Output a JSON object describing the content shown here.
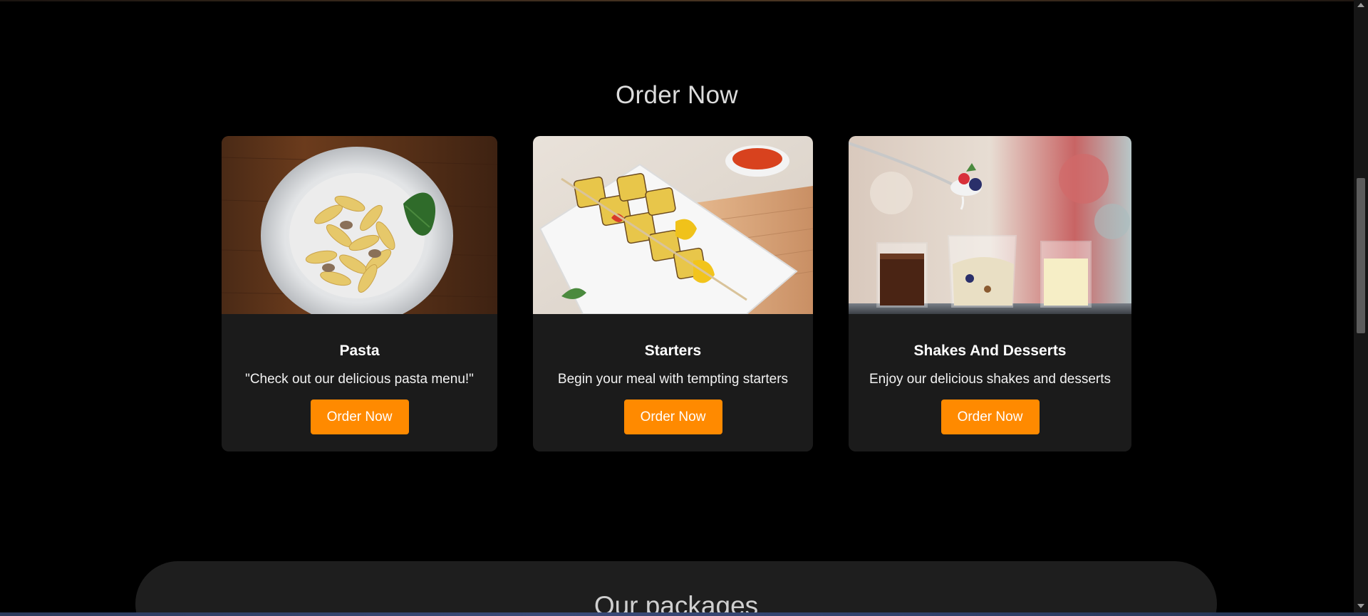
{
  "order_section": {
    "title": "Order Now",
    "cards": [
      {
        "title": "Pasta",
        "description": "\"Check out our delicious pasta menu!\"",
        "button_label": "Order Now",
        "image": "pasta-plate"
      },
      {
        "title": "Starters",
        "description": "Begin your meal with tempting starters",
        "button_label": "Order Now",
        "image": "paneer-tikka-skewers"
      },
      {
        "title": "Shakes And Desserts",
        "description": "Enjoy our delicious shakes and desserts",
        "button_label": "Order Now",
        "image": "shakes-and-desserts-glasses"
      }
    ]
  },
  "packages_section": {
    "title": "Our packages"
  },
  "colors": {
    "background": "#000000",
    "card_background": "#1b1b1b",
    "accent": "#ff8a00",
    "packages_background": "#1e1e1e"
  }
}
